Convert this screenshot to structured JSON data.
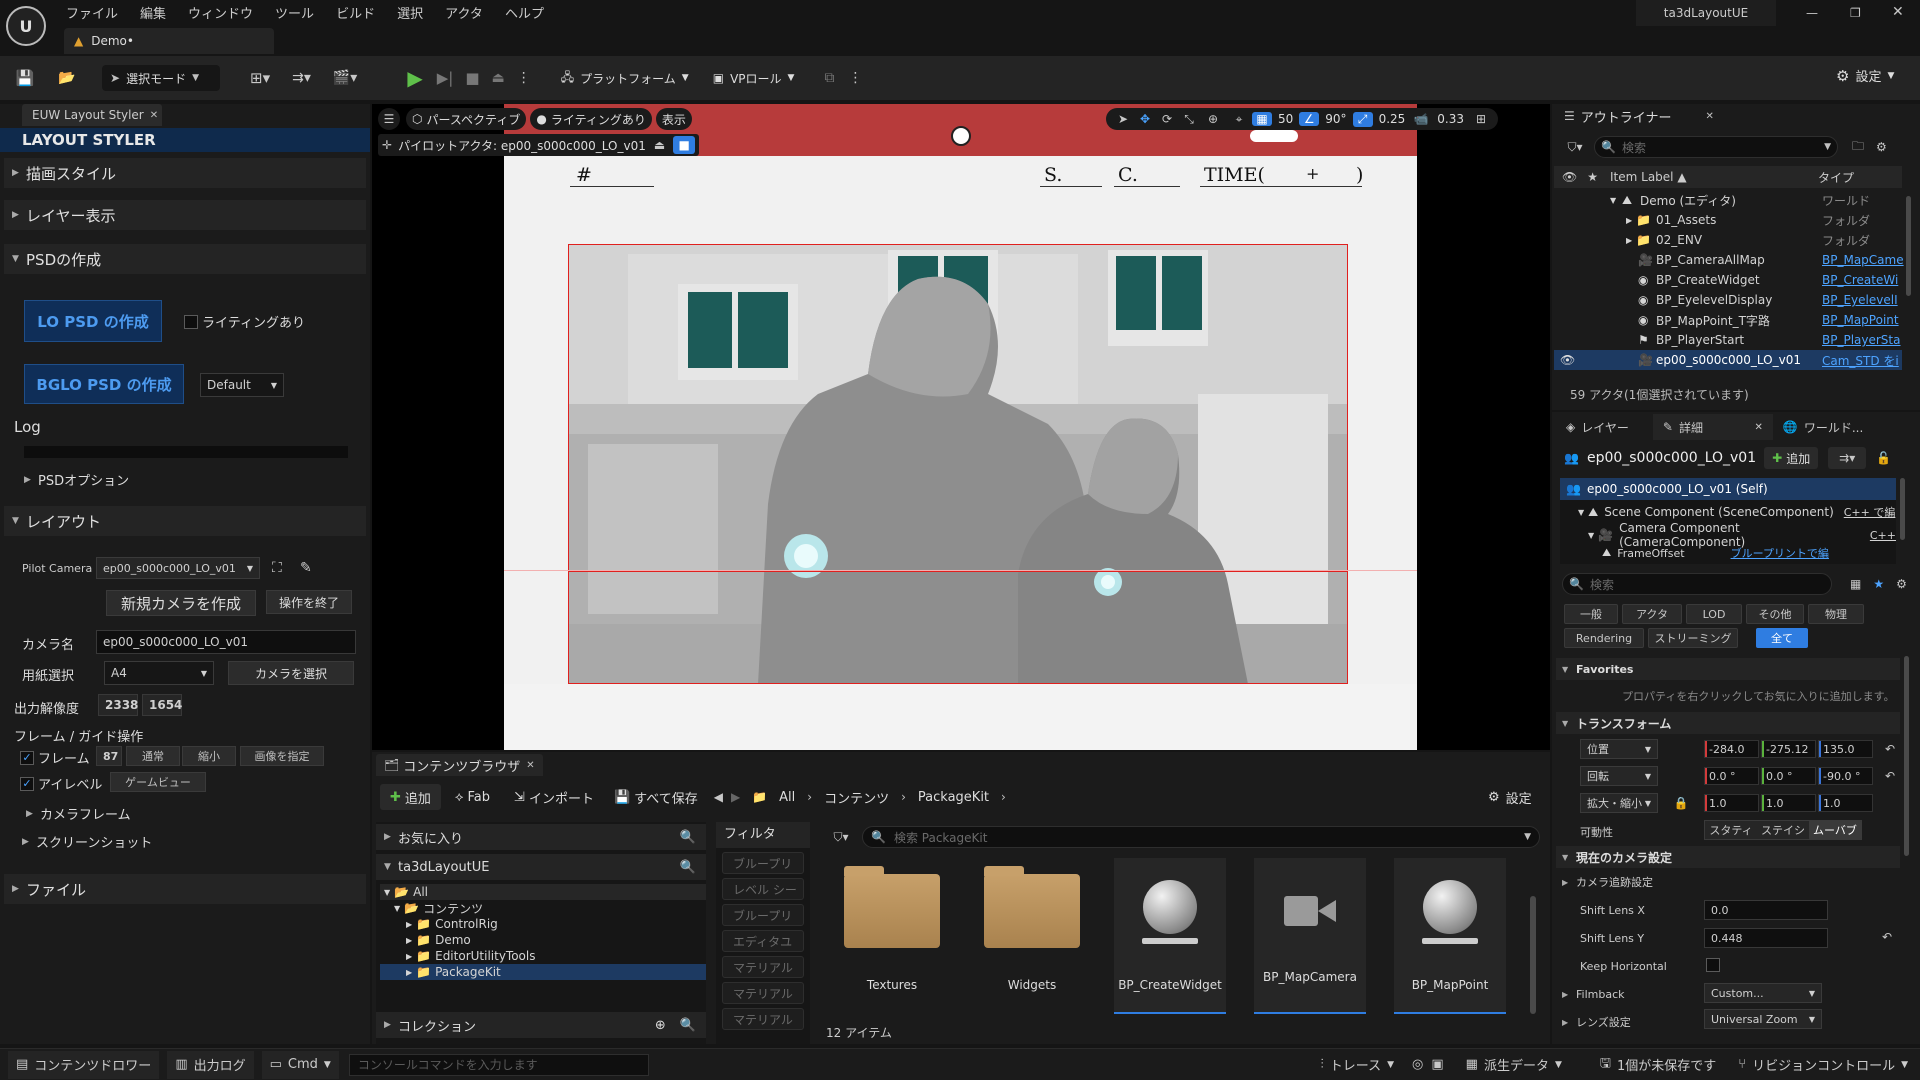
{
  "app": {
    "window_title": "ta3dLayoutUE",
    "tab": "Demo•"
  },
  "menu": [
    "ファイル",
    "編集",
    "ウィンドウ",
    "ツール",
    "ビルド",
    "選択",
    "アクタ",
    "ヘルプ"
  ],
  "toolbar": {
    "mode": "選択モード",
    "platform": "プラットフォーム",
    "vp_role": "VPロール",
    "settings": "設定"
  },
  "euw": {
    "tab": "EUW Layout Styler",
    "title": "LAYOUT STYLER",
    "sec_draw": "描画スタイル",
    "sec_layer": "レイヤー表示",
    "sec_psd": "PSDの作成",
    "lo_psd": "LO PSD の作成",
    "lighting": "ライティングあり",
    "bglo_psd": "BGLO PSD の作成",
    "bglo_default": "Default",
    "log": "Log",
    "psd_options": "PSDオプション",
    "sec_layout": "レイアウト",
    "pilot_label": "Pilot Camera",
    "pilot_value": "ep00_s000c000_LO_v01",
    "new_camera": "新規カメラを作成",
    "end_op": "操作を終了",
    "camera_name_label": "カメラ名",
    "camera_name": "ep00_s000c000_LO_v01",
    "paper_label": "用紙選択",
    "paper": "A4",
    "select_camera": "カメラを選択",
    "res_label": "出力解像度",
    "res_w": "2338",
    "res_h": "1654",
    "frame_guide": "フレーム / ガイド操作",
    "frame": "フレーム",
    "frame_val": "87",
    "normal": "通常",
    "shrink": "縮小",
    "image_spec": "画像を指定",
    "eyelevel": "アイレベル",
    "game_view": "ゲームビュー",
    "camera_frame": "カメラフレーム",
    "screenshot": "スクリーンショット",
    "sec_file": "ファイル"
  },
  "viewport": {
    "perspective": "パースペクティブ",
    "lighting": "ライティングあり",
    "show": "表示",
    "pilot": "パイロットアクタ: ep00_s000c000_LO_v01",
    "grid": "50",
    "angle": "90°",
    "scale": "0.25",
    "cam_speed": "0.33",
    "frame_hash": "#",
    "frame_s": "S.",
    "frame_c": "C.",
    "frame_time": "TIME(",
    "frame_plus": "+",
    "frame_close": ")"
  },
  "outliner": {
    "tab": "アウトライナー",
    "search": "検索",
    "col_label": "Item Label ▲",
    "col_type": "タイプ",
    "items": [
      {
        "label": "Demo (エディタ)",
        "type": "ワールド"
      },
      {
        "label": "01_Assets",
        "type": "フォルダ"
      },
      {
        "label": "02_ENV",
        "type": "フォルダ"
      },
      {
        "label": "BP_CameraAllMap",
        "type": "BP_MapCame"
      },
      {
        "label": "BP_CreateWidget",
        "type": "BP_CreateWi"
      },
      {
        "label": "BP_EyelevelDisplay",
        "type": "BP_EyelevelI"
      },
      {
        "label": "BP_MapPoint_T字路",
        "type": "BP_MapPoint"
      },
      {
        "label": "BP_PlayerStart",
        "type": "BP_PlayerSta"
      },
      {
        "label": "ep00_s000c000_LO_v01",
        "type": "Cam_STD をi"
      }
    ],
    "status": "59 アクタ(1個選択されています)"
  },
  "details": {
    "tab_layer": "レイヤー",
    "tab_details": "詳細",
    "tab_world": "ワールド...",
    "actor": "ep00_s000c000_LO_v01",
    "add": "追加",
    "self": "ep00_s000c000_LO_v01 (Self)",
    "scene": "Scene Component (SceneComponent)",
    "scene_link": "C++ で編",
    "camera": "Camera Component (CameraComponent)",
    "camera_link": "C++",
    "frame_offset": "FrameOffset",
    "frame_offset_link": "ブループリントで編",
    "search": "検索",
    "filters": [
      "一般",
      "アクタ",
      "LOD",
      "その他",
      "物理",
      "Rendering",
      "ストリーミング",
      "全て"
    ],
    "favorites": "Favorites",
    "fav_hint": "プロパティを右クリックしてお気に入りに追加します。",
    "transform": "トランスフォーム",
    "loc": "位置",
    "rot": "回転",
    "scl": "拡大・縮小",
    "loc_v": [
      "-284.0",
      "-275.12",
      "135.0"
    ],
    "rot_v": [
      "0.0 °",
      "0.0 °",
      "-90.0 °"
    ],
    "scl_v": [
      "1.0",
      "1.0",
      "1.0"
    ],
    "mobility": "可動性",
    "mob": [
      "スタティ",
      "ステイシ",
      "ムーバブ"
    ],
    "cam_settings": "現在のカメラ設定",
    "cam_track": "カメラ追跡設定",
    "shift_x": "Shift Lens X",
    "shift_x_v": "0.0",
    "shift_y": "Shift Lens Y",
    "shift_y_v": "0.448",
    "keep_h": "Keep Horizontal",
    "filmback": "Filmback",
    "filmback_v": "Custom...",
    "lens": "レンズ設定",
    "lens_v": "Universal Zoom"
  },
  "content": {
    "tab": "コンテンツブラウザ",
    "add": "追加",
    "fab": "Fab",
    "import": "インポート",
    "save_all": "すべて保存",
    "crumbs": [
      "All",
      "コンテンツ",
      "PackageKit"
    ],
    "settings": "設定",
    "favorites": "お気に入り",
    "project": "ta3dLayoutUE",
    "tree": [
      "All",
      "コンテンツ",
      "ControlRig",
      "Demo",
      "EditorUtilityTools",
      "PackageKit"
    ],
    "collections": "コレクション",
    "filter_title": "フィルタ",
    "filters": [
      "ブループリ",
      "レベル シー",
      "ブループリ",
      "エディタユ",
      "マテリアル",
      "マテリアル",
      "マテリアル"
    ],
    "search": "検索 PackageKit",
    "assets": [
      {
        "name": "Textures",
        "kind": "folder"
      },
      {
        "name": "Widgets",
        "kind": "folder"
      },
      {
        "name": "BP_CreateWidget",
        "kind": "bp"
      },
      {
        "name": "BP_MapCamera",
        "kind": "cam"
      },
      {
        "name": "BP_MapPoint",
        "kind": "bp"
      }
    ],
    "count": "12 アイテム"
  },
  "statusbar": {
    "drawer": "コンテンツドロワー",
    "log": "出力ログ",
    "cmd": "Cmd",
    "console": "コンソールコマンドを入力します",
    "trace": "トレース",
    "derived": "派生データ",
    "unsaved": "1個が未保存です",
    "revision": "リビジョンコントロール"
  },
  "colors": {
    "accent": "#2f7de1",
    "select": "#1d3a62",
    "bp_link": "#4da3ff",
    "frame_red": "#e0201e",
    "viewport_top": "#b73b3b"
  }
}
